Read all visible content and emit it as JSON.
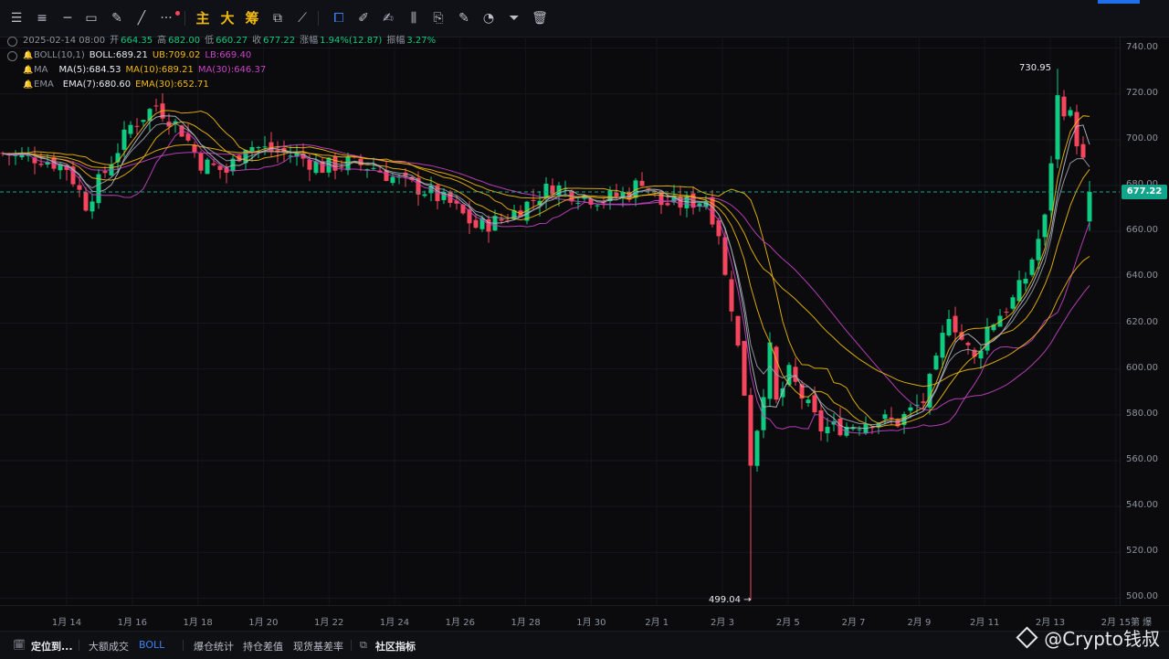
{
  "toolbar": {
    "items": [
      {
        "name": "indicator-settings-icon",
        "glyph": "☰"
      },
      {
        "name": "menu-icon",
        "glyph": "≡"
      },
      {
        "name": "horizontal-line-icon",
        "glyph": "─"
      },
      {
        "name": "rectangle-icon",
        "glyph": "▭"
      },
      {
        "name": "pencil-icon",
        "glyph": "✎"
      },
      {
        "name": "trend-line-icon",
        "glyph": "╱"
      },
      {
        "name": "more-icon",
        "glyph": "···"
      },
      {
        "name": "main-chart-button",
        "glyph": "主"
      },
      {
        "name": "large-trades-button",
        "glyph": "大"
      },
      {
        "name": "chips-button",
        "glyph": "筹"
      },
      {
        "name": "compare-icon",
        "glyph": "⧉"
      },
      {
        "name": "measure-icon",
        "glyph": "⟋"
      },
      {
        "name": "magnet-icon",
        "glyph": "⧠"
      },
      {
        "name": "ruler-icon",
        "glyph": "✐"
      },
      {
        "name": "draw-icon",
        "glyph": "✍"
      },
      {
        "name": "candles-icon",
        "glyph": "⫼"
      },
      {
        "name": "clipboard-icon",
        "glyph": "⎘"
      },
      {
        "name": "note-icon",
        "glyph": "✎"
      },
      {
        "name": "palette-icon",
        "glyph": "◔"
      },
      {
        "name": "filter-icon",
        "glyph": "⏷"
      },
      {
        "name": "trash-icon",
        "glyph": "🗑"
      }
    ]
  },
  "legend": {
    "date": "2025-02-14 08:00",
    "open_label": "开",
    "open": "664.35",
    "high_label": "高",
    "high": "682.00",
    "low_label": "低",
    "low": "660.27",
    "close_label": "收",
    "close": "677.22",
    "change_label": "涨幅",
    "change": "1.94%(12.87)",
    "amp_label": "振幅",
    "amp": "3.27%",
    "boll_name": "BOLL(10,1)",
    "boll": "BOLL:689.21",
    "boll_ub": "UB:709.02",
    "boll_lb": "LB:669.40",
    "ma_name": "MA",
    "ma5": "MA(5):684.53",
    "ma10": "MA(10):689.21",
    "ma30": "MA(30):646.37",
    "ema_name": "EMA",
    "ema7": "EMA(7):680.60",
    "ema30": "EMA(30):652.71"
  },
  "price_tag": "677.22",
  "high_marker": "730.95",
  "low_marker": "499.04 →",
  "colors": {
    "up": "#0ecb81",
    "down": "#f6465d",
    "ma5": "#e8eaee",
    "ma10": "#f0b90b",
    "ma30": "#c743c5",
    "ema7": "#e8eaee",
    "ema30": "#f0b90b",
    "boll": "#f0b90b",
    "price_line": "#13a58b"
  },
  "chart_data": {
    "type": "candlestick",
    "y_ticks": [
      "740.00",
      "720.00",
      "700.00",
      "680.00",
      "660.00",
      "640.00",
      "620.00",
      "600.00",
      "580.00",
      "560.00",
      "540.00",
      "520.00",
      "500.00"
    ],
    "ylim": [
      497,
      745
    ],
    "x_labels": [
      "1月 14",
      "1月 16",
      "1月 18",
      "1月 20",
      "1月 22",
      "1月 24",
      "1月 26",
      "1月 28",
      "1月 30",
      "2月 1",
      "2月 3",
      "2月 5",
      "2月 7",
      "2月 9",
      "2月 11",
      "2月 13",
      "2月 15"
    ],
    "x_extra": "第 爆",
    "series": [
      {
        "name": "MA(5)",
        "current": 684.53
      },
      {
        "name": "MA(10)",
        "current": 689.21
      },
      {
        "name": "MA(30)",
        "current": 646.37
      },
      {
        "name": "EMA(7)",
        "current": 680.6
      },
      {
        "name": "EMA(30)",
        "current": 652.71
      }
    ],
    "price_path": [
      [
        0,
        694
      ],
      [
        6,
        692
      ],
      [
        10,
        688
      ],
      [
        13,
        672
      ],
      [
        16,
        686
      ],
      [
        20,
        706
      ],
      [
        24,
        715
      ],
      [
        28,
        704
      ],
      [
        31,
        690
      ],
      [
        35,
        686
      ],
      [
        38,
        698
      ],
      [
        42,
        695
      ],
      [
        46,
        693
      ],
      [
        50,
        688
      ],
      [
        54,
        690
      ],
      [
        58,
        688
      ],
      [
        62,
        682
      ],
      [
        66,
        678
      ],
      [
        70,
        672
      ],
      [
        74,
        662
      ],
      [
        78,
        665
      ],
      [
        82,
        672
      ],
      [
        86,
        680
      ],
      [
        90,
        676
      ],
      [
        94,
        674
      ],
      [
        98,
        677
      ],
      [
        100,
        683
      ],
      [
        103,
        672
      ],
      [
        106,
        672
      ],
      [
        110,
        674
      ],
      [
        112,
        660
      ],
      [
        113,
        640
      ],
      [
        114,
        628
      ],
      [
        116,
        590
      ],
      [
        117,
        560
      ],
      [
        118,
        575
      ],
      [
        120,
        608
      ],
      [
        121,
        585
      ],
      [
        123,
        598
      ],
      [
        126,
        583
      ],
      [
        128,
        574
      ],
      [
        132,
        575
      ],
      [
        136,
        578
      ],
      [
        140,
        577
      ],
      [
        144,
        586
      ],
      [
        146,
        602
      ],
      [
        148,
        625
      ],
      [
        150,
        613
      ],
      [
        152,
        604
      ],
      [
        154,
        618
      ],
      [
        158,
        630
      ],
      [
        160,
        640
      ],
      [
        163,
        665
      ],
      [
        165,
        718
      ],
      [
        167,
        710
      ],
      [
        169,
        690
      ],
      [
        170,
        677.22
      ]
    ],
    "time_span": "2025-01-13 to 2025-02-14, 4h candles"
  },
  "bottom_bar": {
    "items": [
      "定位到...",
      "大额成交",
      "BOLL",
      "爆仓统计",
      "持仓差值",
      "现货基差率",
      "社区指标"
    ]
  },
  "watermark": "@Crypto钱叔"
}
